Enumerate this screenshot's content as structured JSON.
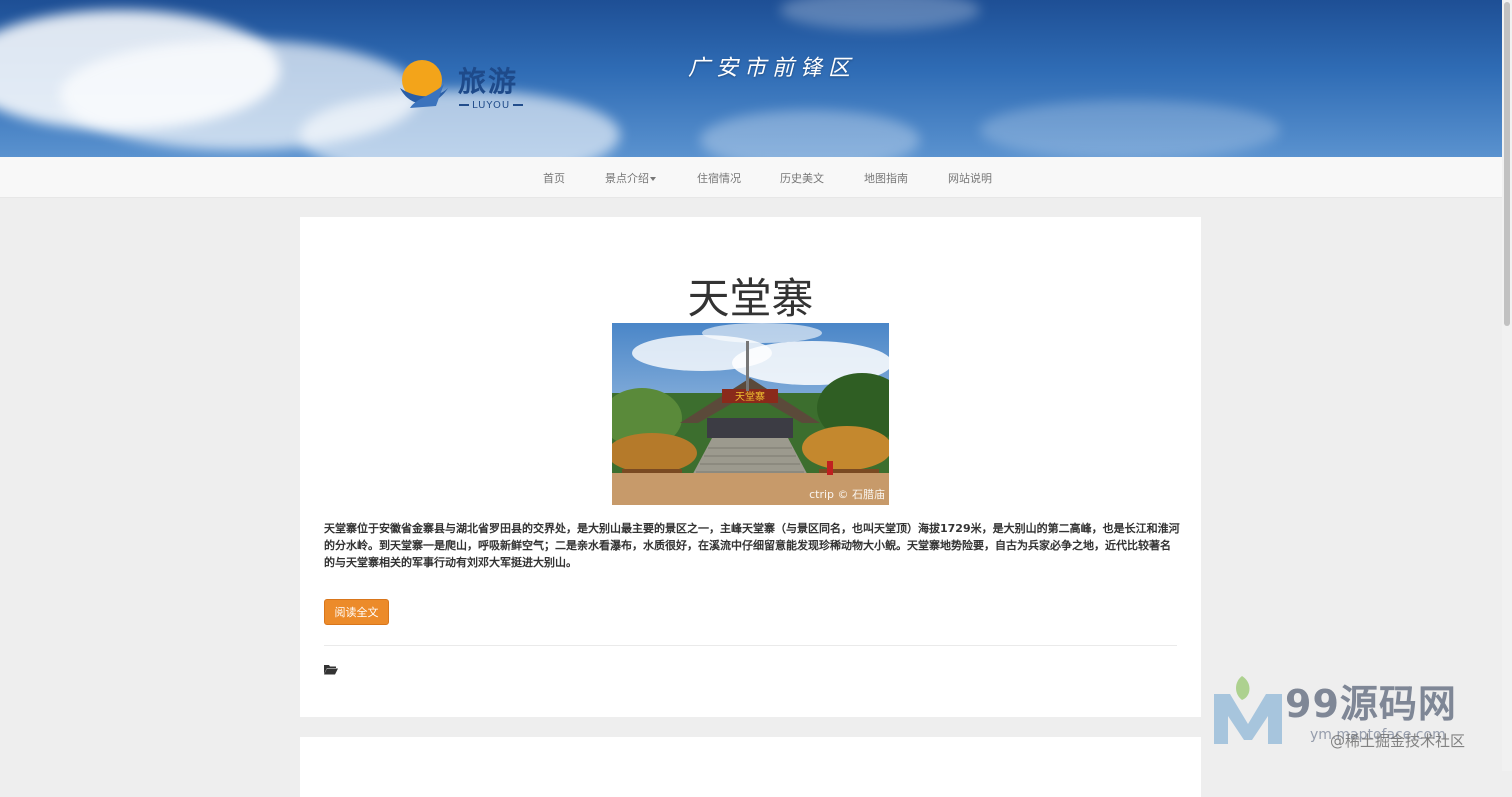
{
  "header": {
    "logo_text": "旅游",
    "logo_sub": "LUYOU",
    "site_title": "广安市前锋区"
  },
  "nav": {
    "items": [
      {
        "label": "首页"
      },
      {
        "label": "景点介绍",
        "has_dropdown": true
      },
      {
        "label": "住宿情况"
      },
      {
        "label": "历史美文"
      },
      {
        "label": "地图指南"
      },
      {
        "label": "网站说明"
      }
    ]
  },
  "post": {
    "title": "天堂寨",
    "image_credit": "ctrip © 石腊庙",
    "image_sign": "天堂寨",
    "body": "天堂寨位于安徽省金寨县与湖北省罗田县的交界处，是大别山最主要的景区之一，主峰天堂寨（与景区同名，也叫天堂顶）海拔1729米，是大别山的第二高峰，也是长江和淮河的分水岭。到天堂寨一是爬山，呼吸新鲜空气；二是亲水看瀑布，水质很好，在溪流中仔细留意能发现珍稀动物大小鲵。天堂寨地势险要，自古为兵家必争之地，近代比较著名的与天堂寨相关的军事行动有刘邓大军挺进大别山。",
    "read_more": "阅读全文"
  },
  "watermark": {
    "brand": "99源码网",
    "url": "ym.maptoface.com",
    "community": "@稀土掘金技术社区"
  },
  "colors": {
    "accent_button": "#ec8b2a",
    "nav_bg": "#f8f8f8",
    "page_bg": "#eeeeee"
  }
}
